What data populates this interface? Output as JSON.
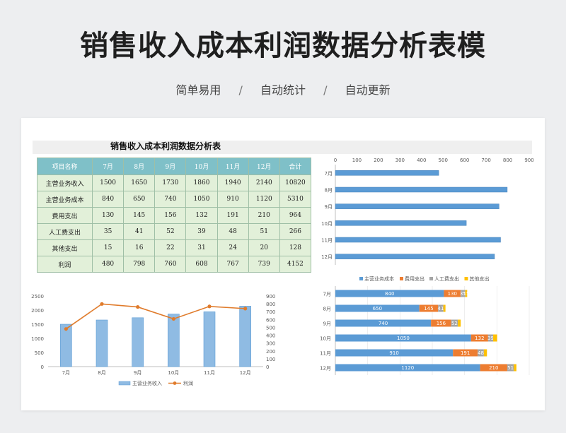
{
  "page": {
    "title": "销售收入成本利润数据分析表模",
    "subtitle": [
      "简单易用",
      "自动统计",
      "自动更新"
    ],
    "separator": "/"
  },
  "sheet": {
    "title": "销售收入成本利润数据分析表",
    "header": [
      "项目名称",
      "7月",
      "8月",
      "9月",
      "10月",
      "11月",
      "12月",
      "合计"
    ],
    "rows": [
      [
        "主营业务收入",
        "1500",
        "1650",
        "1730",
        "1860",
        "1940",
        "2140",
        "10820"
      ],
      [
        "主营业务成本",
        "840",
        "650",
        "740",
        "1050",
        "910",
        "1120",
        "5310"
      ],
      [
        "费用支出",
        "130",
        "145",
        "156",
        "132",
        "191",
        "210",
        "964"
      ],
      [
        "人工费支出",
        "35",
        "41",
        "52",
        "39",
        "48",
        "51",
        "266"
      ],
      [
        "其他支出",
        "15",
        "16",
        "22",
        "31",
        "24",
        "20",
        "128"
      ],
      [
        "利润",
        "480",
        "798",
        "760",
        "608",
        "767",
        "739",
        "4152"
      ]
    ]
  },
  "colors": {
    "header_bg": "#7fc0c8",
    "cell_bg": "#e2f0d9",
    "bar_blue": "#5b9bd5",
    "bar_orange": "#ed7d31",
    "bar_gray": "#a5a5a5",
    "bar_yellow": "#ffc000",
    "line_orange": "#e07b2b"
  },
  "chart_data": [
    {
      "type": "bar",
      "orientation": "horizontal",
      "categories": [
        "7月",
        "8月",
        "9月",
        "10月",
        "11月",
        "12月"
      ],
      "values": [
        480,
        798,
        760,
        608,
        767,
        739
      ],
      "xlim": [
        0,
        900
      ],
      "xticks": [
        "0",
        "100",
        "200",
        "300",
        "400",
        "500",
        "600",
        "700",
        "800",
        "900"
      ],
      "axis_position": "top",
      "grid": false
    },
    {
      "type": "bar",
      "orientation": "horizontal",
      "stacked": true,
      "categories": [
        "7月",
        "8月",
        "9月",
        "10月",
        "11月",
        "12月"
      ],
      "series": [
        {
          "name": "主营业务成本",
          "values": [
            840,
            650,
            740,
            1050,
            910,
            1120
          ]
        },
        {
          "name": "费用支出",
          "values": [
            130,
            145,
            156,
            132,
            191,
            210
          ]
        },
        {
          "name": "人工费支出",
          "values": [
            35,
            41,
            52,
            39,
            48,
            51
          ]
        },
        {
          "name": "其他支出",
          "values": [
            15,
            16,
            22,
            31,
            24,
            20
          ]
        }
      ],
      "labels": [
        [
          "840",
          "130",
          "35",
          "15"
        ],
        [
          "650",
          "145",
          "41",
          ""
        ],
        [
          "740",
          "156",
          "52",
          ""
        ],
        [
          "1050",
          "132",
          "39",
          ""
        ],
        [
          "910",
          "191",
          "48",
          ""
        ],
        [
          "1120",
          "210",
          "51",
          ""
        ]
      ],
      "legend": "top",
      "grid": true
    },
    {
      "type": "bar+line",
      "categories": [
        "7月",
        "8月",
        "9月",
        "10月",
        "11月",
        "12月"
      ],
      "series": [
        {
          "name": "主营业务收入",
          "type": "bar",
          "axis": "left",
          "values": [
            1500,
            1650,
            1730,
            1860,
            1940,
            2140
          ]
        },
        {
          "name": "利润",
          "type": "line",
          "axis": "right",
          "values": [
            480,
            798,
            760,
            608,
            767,
            739
          ]
        }
      ],
      "ylim": [
        0,
        2500
      ],
      "yticks": [
        "0",
        "500",
        "1000",
        "1500",
        "2000",
        "2500"
      ],
      "y2lim": [
        0,
        900
      ],
      "y2ticks": [
        "0",
        "100",
        "200",
        "300",
        "400",
        "500",
        "600",
        "700",
        "800",
        "900"
      ],
      "legend": "bottom",
      "grid": false
    }
  ]
}
